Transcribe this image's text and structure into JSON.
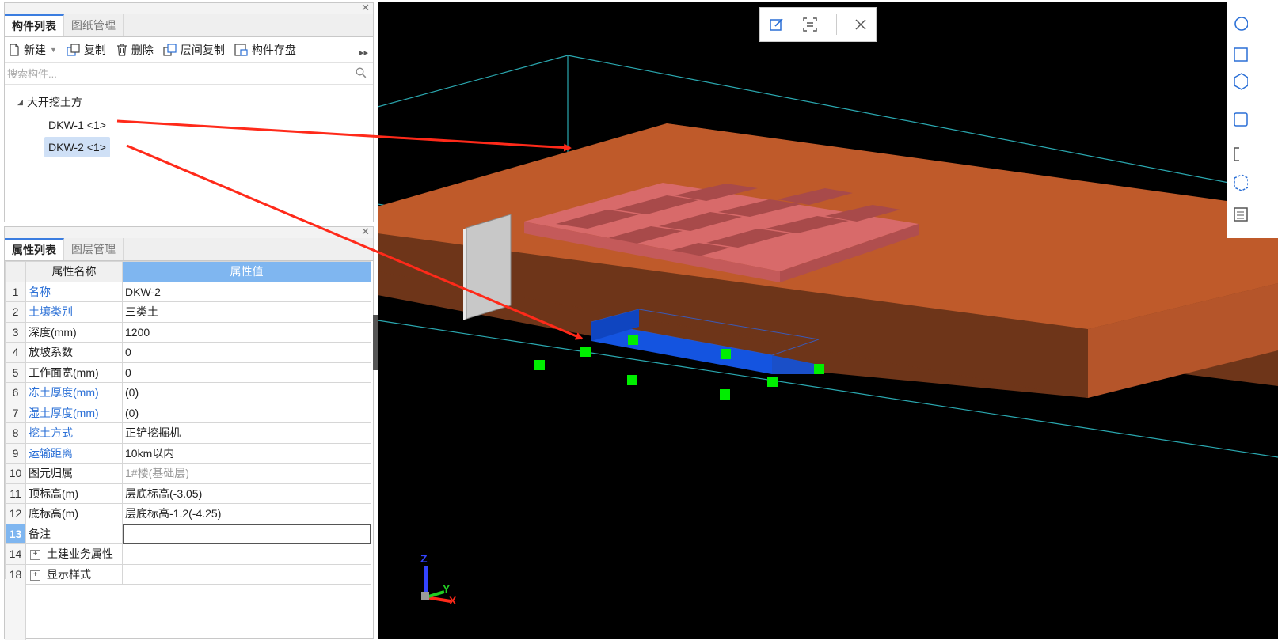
{
  "component_panel": {
    "tabs": [
      "构件列表",
      "图纸管理"
    ],
    "toolbar": {
      "new": "新建",
      "copy": "复制",
      "delete": "删除",
      "floor_copy": "层间复制",
      "save": "构件存盘"
    },
    "search_placeholder": "搜索构件...",
    "tree": {
      "group": "大开挖土方",
      "items": [
        "DKW-1 <1>",
        "DKW-2 <1>"
      ],
      "selected": "DKW-2 <1>"
    }
  },
  "property_panel": {
    "tabs": [
      "属性列表",
      "图层管理"
    ],
    "headers": {
      "name": "属性名称",
      "value": "属性值"
    },
    "rows": [
      {
        "num": "1",
        "name": "名称",
        "value": "DKW-2"
      },
      {
        "num": "2",
        "name": "土壤类别",
        "value": "三类土"
      },
      {
        "num": "3",
        "name": "深度(mm)",
        "value": "1200"
      },
      {
        "num": "4",
        "name": "放坡系数",
        "value": "0"
      },
      {
        "num": "5",
        "name": "工作面宽(mm)",
        "value": "0"
      },
      {
        "num": "6",
        "name": "冻土厚度(mm)",
        "value": "(0)"
      },
      {
        "num": "7",
        "name": "湿土厚度(mm)",
        "value": "(0)"
      },
      {
        "num": "8",
        "name": "挖土方式",
        "value": "正铲挖掘机"
      },
      {
        "num": "9",
        "name": "运输距离",
        "value": "10km以内"
      },
      {
        "num": "10",
        "name": "图元归属",
        "value": "1#楼(基础层)"
      },
      {
        "num": "11",
        "name": "顶标高(m)",
        "value": "层底标高(-3.05)"
      },
      {
        "num": "12",
        "name": "底标高(m)",
        "value": "层底标高-1.2(-4.25)"
      },
      {
        "num": "13",
        "name": "备注",
        "value": ""
      },
      {
        "num": "14",
        "name": "土建业务属性",
        "value": ""
      },
      {
        "num": "18",
        "name": "显示样式",
        "value": ""
      }
    ]
  },
  "viewport": {
    "axis_labels": {
      "x": "X",
      "y": "Y",
      "z": "Z"
    },
    "colors": {
      "background": "#000000",
      "excavation_top": "#bf5a2a",
      "excavation_side": "#6e3519",
      "foundation_grid": "#d86a6a",
      "selected_pit": "#1454e0",
      "grip": "#00ee00",
      "annotation_arrow": "#ff2a1a",
      "bounding_line": "#2aa8b0"
    }
  }
}
